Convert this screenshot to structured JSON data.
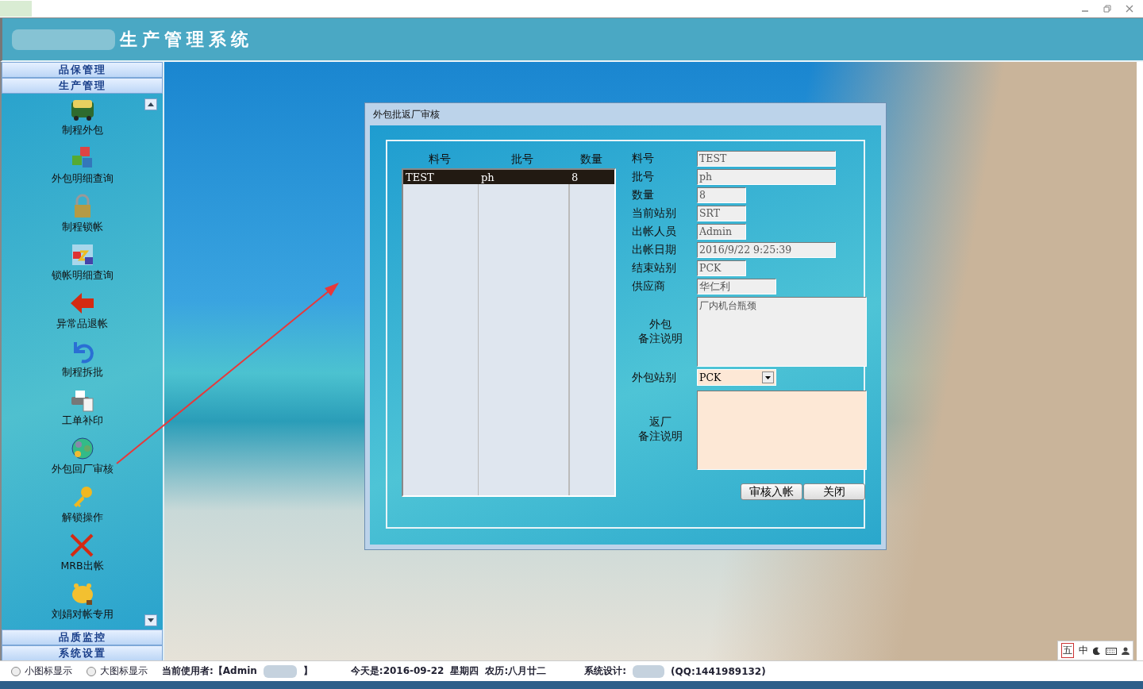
{
  "window": {
    "title": "生产管理系统"
  },
  "sidebar": {
    "groups": [
      {
        "label": "品保管理",
        "expanded": false
      },
      {
        "label": "生产管理",
        "expanded": true,
        "items": [
          {
            "label": "制程外包",
            "kind": "bus"
          },
          {
            "label": "外包明细查询",
            "kind": "cubes"
          },
          {
            "label": "制程锁帐",
            "kind": "padlock"
          },
          {
            "label": "锁帐明细查询",
            "kind": "locks"
          },
          {
            "label": "异常品退帐",
            "kind": "arrow"
          },
          {
            "label": "制程拆批",
            "kind": "undo"
          },
          {
            "label": "工单补印",
            "kind": "printer"
          },
          {
            "label": "外包回厂审核",
            "kind": "globe"
          },
          {
            "label": "解锁操作",
            "kind": "key"
          },
          {
            "label": "MRB出帐",
            "kind": "cross"
          },
          {
            "label": "刘娟对帐专用",
            "kind": "piggy"
          }
        ]
      },
      {
        "label": "品质监控",
        "expanded": false
      },
      {
        "label": "系统设置",
        "expanded": false
      }
    ]
  },
  "dialog": {
    "title": "外包批返厂审核",
    "table": {
      "columns": [
        "料号",
        "批号",
        "数量"
      ],
      "rows": [
        {
          "cells": [
            "TEST",
            "ph",
            "8"
          ],
          "selected": true
        }
      ]
    },
    "fields": [
      {
        "label": "料号",
        "value": "TEST",
        "kind": "text"
      },
      {
        "label": "批号",
        "value": "ph",
        "kind": "text"
      },
      {
        "label": "数量",
        "value": "8",
        "kind": "text"
      },
      {
        "label": "当前站别",
        "value": "SRT",
        "kind": "text"
      },
      {
        "label": "出帐人员",
        "value": "Admin",
        "kind": "text"
      },
      {
        "label": "出帐日期",
        "value": "2016/9/22 9:25:39",
        "kind": "text"
      },
      {
        "label": "结束站别",
        "value": "PCK",
        "kind": "text"
      },
      {
        "label": "供应商",
        "value": "华仁利",
        "kind": "text"
      },
      {
        "label_lines": [
          "外包",
          "备注说明"
        ],
        "value": "厂内机台瓶颈",
        "kind": "memo"
      },
      {
        "label": "外包站别",
        "value": "PCK",
        "kind": "select"
      },
      {
        "label_lines": [
          "返厂",
          "备注说明"
        ],
        "kind": "editmemo"
      }
    ],
    "buttons": [
      "审核入帐",
      "关闭"
    ]
  },
  "status_bar": {
    "radios": [
      {
        "label": "小图标显示",
        "selected": false
      },
      {
        "label": "大图标显示",
        "selected": false
      }
    ],
    "user_label": "当前使用者:【Admin",
    "user_end": "】",
    "date": "今天是:2016-09-22",
    "weekday": "星期四",
    "lunar": "农历:八月廿二",
    "designer_label": "系统设计:",
    "contact": "(QQ:1441989132)"
  },
  "ime_bar": {
    "items": [
      "五",
      "中"
    ]
  }
}
